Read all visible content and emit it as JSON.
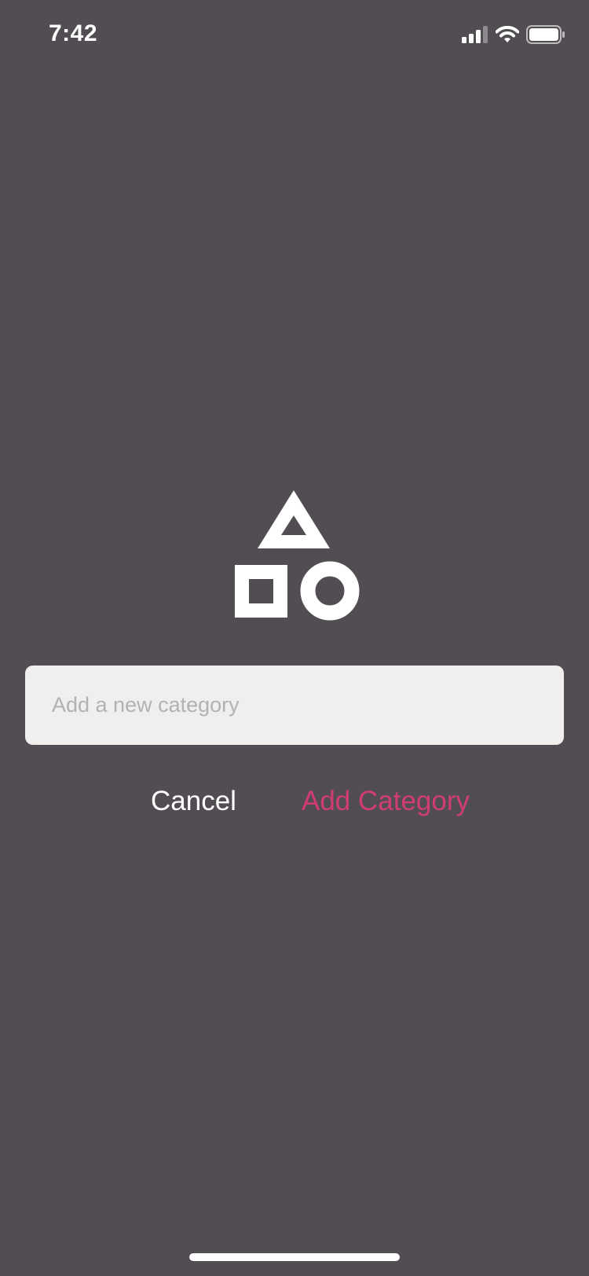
{
  "status_bar": {
    "time": "7:42",
    "icons": [
      "cellular-signal-icon",
      "wifi-icon",
      "battery-icon"
    ]
  },
  "logo": {
    "icon": "shapes-icon",
    "color": "#ffffff"
  },
  "category_input": {
    "value": "",
    "placeholder": "Add a new category"
  },
  "actions": {
    "cancel_label": "Cancel",
    "add_label": "Add Category"
  },
  "colors": {
    "background": "#524d52",
    "accent": "#d13c76",
    "input_background": "#f0efed",
    "placeholder": "#b4b1b6"
  }
}
